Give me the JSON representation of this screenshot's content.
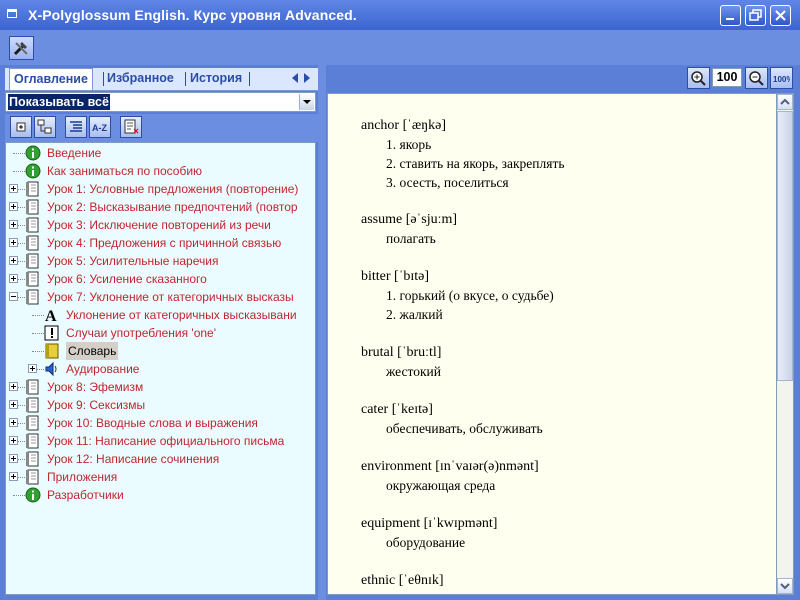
{
  "window": {
    "title": "X-Polyglossum English. Курс уровня Advanced."
  },
  "toolbar": {
    "tools_icon": "tools-icon"
  },
  "tabs": [
    {
      "label": "Оглавление",
      "active": true
    },
    {
      "label": "Избранное",
      "active": false
    },
    {
      "label": "История",
      "active": false
    }
  ],
  "filter": {
    "value": "Показывать всё"
  },
  "tree_tools": [
    {
      "icon": "expand-all-icon"
    },
    {
      "icon": "tree-view-icon"
    },
    {
      "icon": "list-view-icon"
    },
    {
      "icon": "sort-az-icon",
      "text": "A-Z"
    },
    {
      "icon": "bookmark-add-icon"
    }
  ],
  "tree": [
    {
      "label": "Введение",
      "icon": "info-icon"
    },
    {
      "label": "Как заниматься по пособию",
      "icon": "info-icon"
    },
    {
      "label": "Урок 1: Условные предложения (повторение)",
      "icon": "book-icon"
    },
    {
      "label": "Урок 2: Высказывание предпочтений (повтор",
      "icon": "book-icon"
    },
    {
      "label": "Урок 3: Исключение повторений из речи",
      "icon": "book-icon"
    },
    {
      "label": "Урок 4: Предложения с причинной связью",
      "icon": "book-icon"
    },
    {
      "label": "Урок 5: Усилительные наречия",
      "icon": "book-icon"
    },
    {
      "label": "Урок 6: Усиление сказанного",
      "icon": "book-icon"
    },
    {
      "label": "Урок 7: Уклонение от категоричных высказы",
      "icon": "book-icon"
    },
    {
      "label": "Уклонение от категоричных высказывани",
      "icon": "grammar-icon"
    },
    {
      "label": "Случаи употребления 'one'",
      "icon": "warning-icon"
    },
    {
      "label": "Словарь",
      "icon": "dictionary-icon"
    },
    {
      "label": "Аудирование",
      "icon": "speaker-icon"
    },
    {
      "label": "Урок 8: Эфемизм",
      "icon": "book-icon"
    },
    {
      "label": "Урок 9: Сексизмы",
      "icon": "book-icon"
    },
    {
      "label": "Урок 10: Вводные слова и выражения",
      "icon": "book-icon"
    },
    {
      "label": "Урок 11: Написание официального письма",
      "icon": "book-icon"
    },
    {
      "label": "Урок 12: Написание сочинения",
      "icon": "book-icon"
    },
    {
      "label": "Приложения",
      "icon": "book-icon"
    },
    {
      "label": "Разработчики",
      "icon": "info-icon"
    }
  ],
  "zoom": {
    "value": "100"
  },
  "vocabulary": [
    {
      "word": "anchor [ˈæŋkə]",
      "defs": [
        "1. якорь",
        "2. ставить на якорь, закреплять",
        "3. осесть, поселиться"
      ]
    },
    {
      "word": "assume [əˈsjuːm]",
      "defs": [
        "полагать"
      ]
    },
    {
      "word": "bitter [ˈbɪtə]",
      "defs": [
        "1. горький (о вкусе, о судьбе)",
        "2. жалкий"
      ]
    },
    {
      "word": "brutal [ˈbruːtl]",
      "defs": [
        "жестокий"
      ]
    },
    {
      "word": "cater [ˈkeɪtə]",
      "defs": [
        "обеспечивать, обслуживать"
      ]
    },
    {
      "word": "environment [ɪnˈvaɪər(ə)nmənt]",
      "defs": [
        "окружающая среда"
      ]
    },
    {
      "word": "equipment [ɪˈkwɪpmənt]",
      "defs": [
        "оборудование"
      ]
    },
    {
      "word": "ethnic [ˈeθnɪk]",
      "defs": []
    }
  ]
}
